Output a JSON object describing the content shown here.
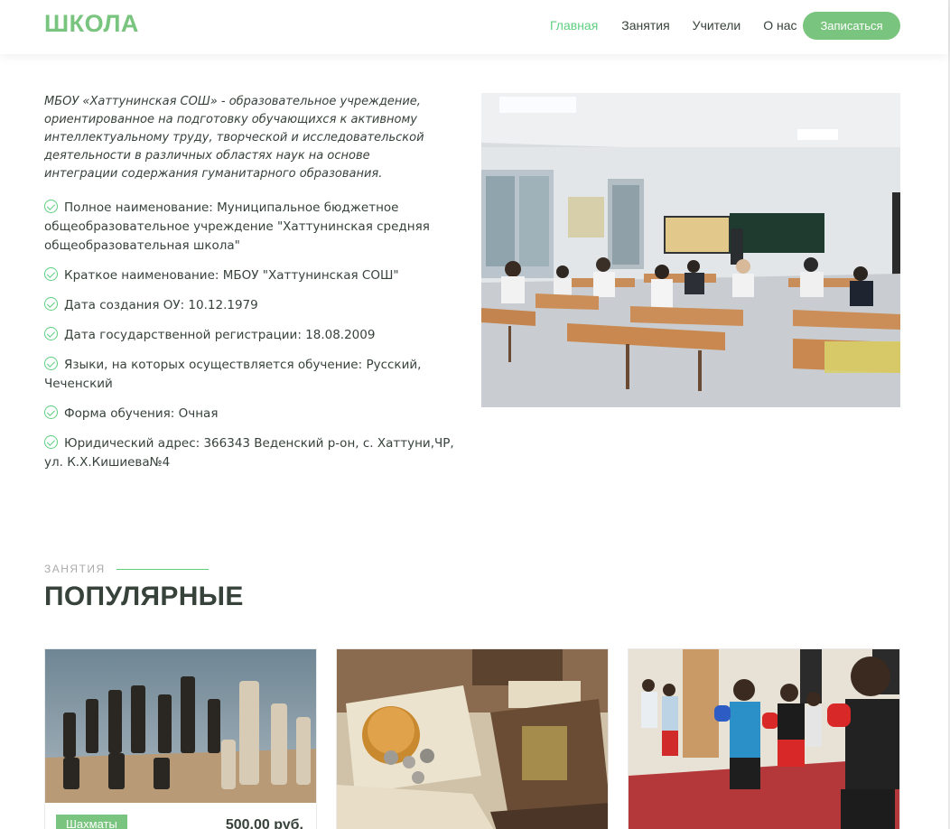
{
  "header": {
    "logo": "ШКОЛА",
    "nav": [
      "Главная",
      "Занятия",
      "Учители",
      "О нас"
    ],
    "active_nav": "Главная",
    "cta_label": "Записаться"
  },
  "about": {
    "intro": "МБОУ «Хаттунинская СОШ» - образовательное учреждение, ориентированное на подготовку обучающихся к активному интеллектуальному труду, творческой и исследовательской деятельности в различных областях наук на основе интеграции содержания гуманитарного образования.",
    "facts": [
      "Полное наименование: Муниципальное бюджетное общеобразовательное учреждение \"Хаттунинская средняя общеобразовательная школа\"",
      "Краткое наименование: МБОУ \"Хаттунинская СОШ\"",
      "Дата создания ОУ: 10.12.1979",
      "Дата государственной регистрации: 18.08.2009",
      "Языки, на которых осуществляется обучение: Русский, Чеченский",
      "Форма обучения: Очная",
      "Юридический адрес: 366343 Веденский р-он, с. Хаттуни,ЧР, ул. К.Х.Кишиева№4"
    ]
  },
  "courses": {
    "subtitle": "Занятия",
    "title": "ПОПУЛЯРНЫЕ",
    "cards": [
      {
        "tag": "Шахматы",
        "price": "500,00 руб."
      },
      {
        "tag": "",
        "price": ""
      },
      {
        "tag": "",
        "price": ""
      }
    ]
  },
  "colors": {
    "accent": "#5fcf80",
    "button": "#79c47e",
    "text": "#37423b"
  }
}
